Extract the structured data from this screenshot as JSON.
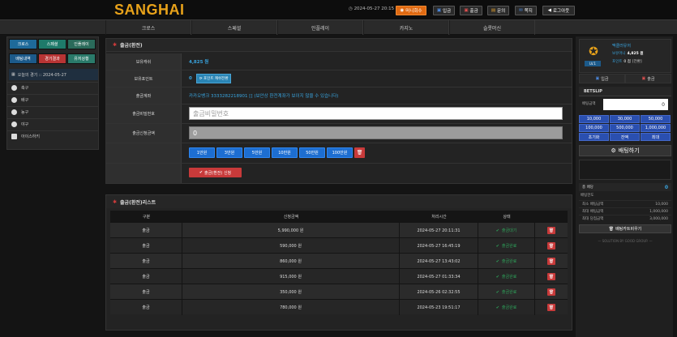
{
  "header": {
    "logo": "SANGHAI",
    "datetime": "2024-05-27 20:15",
    "buttons": [
      "머니회수",
      "입금",
      "출금",
      "문의",
      "쪽지",
      "로그아웃"
    ]
  },
  "nav": [
    "크로스",
    "스페셜",
    "인플레이",
    "카지노",
    "슬롯머신"
  ],
  "leftbar": {
    "tabs": [
      "크로스",
      "스페셜",
      "인플레이",
      "배팅내역",
      "경기결과",
      "유저상황"
    ],
    "date_label": "오늘의 경기 :: 2024-05-27",
    "sports": [
      "축구",
      "배구",
      "농구",
      "야구",
      "아이스하키"
    ]
  },
  "withdraw": {
    "title": "출금(환전)",
    "rows": {
      "balance_label": "보유캐쉬",
      "balance_value": "4,825 원",
      "points_label": "보유포인트",
      "points_value": "0",
      "points_btn": "포인트 캐쉬전환",
      "account_label": "출금계좌",
      "account_value": "카카오뱅크 3333282218901 [] (보안상 환전계좌가 보이지 않을 수 있습니다)",
      "password_label": "출금비밀번호",
      "password_placeholder": "출금비밀번호",
      "amount_label": "출금신청금액",
      "amount_value": "0",
      "amount_buttons": [
        "1만원",
        "3만원",
        "5만원",
        "10만원",
        "50만원",
        "100만원"
      ],
      "submit": "출금(환전) 신청"
    }
  },
  "list": {
    "title": "출금(환전)리스트",
    "columns": [
      "구분",
      "신청금액",
      "처리시간",
      "상태"
    ],
    "rows": [
      {
        "type": "출금",
        "amount": "5,990,000 원",
        "time": "2024-05-27 20:11:31",
        "status": "출금대기"
      },
      {
        "type": "출금",
        "amount": "590,000 원",
        "time": "2024-05-27 16:45:19",
        "status": "출금완료"
      },
      {
        "type": "출금",
        "amount": "860,000 원",
        "time": "2024-05-27 13:43:02",
        "status": "출금완료"
      },
      {
        "type": "출금",
        "amount": "915,000 원",
        "time": "2024-05-27 01:33:34",
        "status": "출금완료"
      },
      {
        "type": "출금",
        "amount": "350,000 원",
        "time": "2024-05-26 02:32:55",
        "status": "출금완료"
      },
      {
        "type": "출금",
        "amount": "780,000 원",
        "time": "2024-05-23 19:51:17",
        "status": "출금완료"
      }
    ]
  },
  "rightbar": {
    "user_level": "LV.1",
    "user_name": "맥클러유저",
    "cash_label": "보유머니",
    "cash_value": "4,825 원",
    "point_label": "포인트",
    "point_value": "0 점",
    "point_action": "[전환]",
    "deposit": "입금",
    "withdraw": "출금",
    "betslip_title": "BETSLIP",
    "bet_amount_label": "배팅금액",
    "bet_amount_value": "0",
    "quick": [
      "10,000",
      "30,000",
      "50,000",
      "100,000",
      "500,000",
      "1,000,000",
      "초기화",
      "잔액",
      "최대"
    ],
    "bet_button": "배팅하기",
    "odds_label": "총 배당",
    "odds_value": "0",
    "limit_label": "배팅한도",
    "limits": [
      {
        "label": "최소 배팅금액",
        "value": "10,000"
      },
      {
        "label": "최대 배팅금액",
        "value": "1,000,000"
      },
      {
        "label": "최대 당첨금액",
        "value": "3,000,000"
      }
    ],
    "clear_button": "배팅카트비우기",
    "footer": "— SOLUTION BY GOOD GROUP. —"
  },
  "colors": {
    "accent_orange": "#e8a21a",
    "primary_blue": "#1d6ed1",
    "danger_red": "#c83a3a",
    "success_green": "#2ea35a"
  }
}
